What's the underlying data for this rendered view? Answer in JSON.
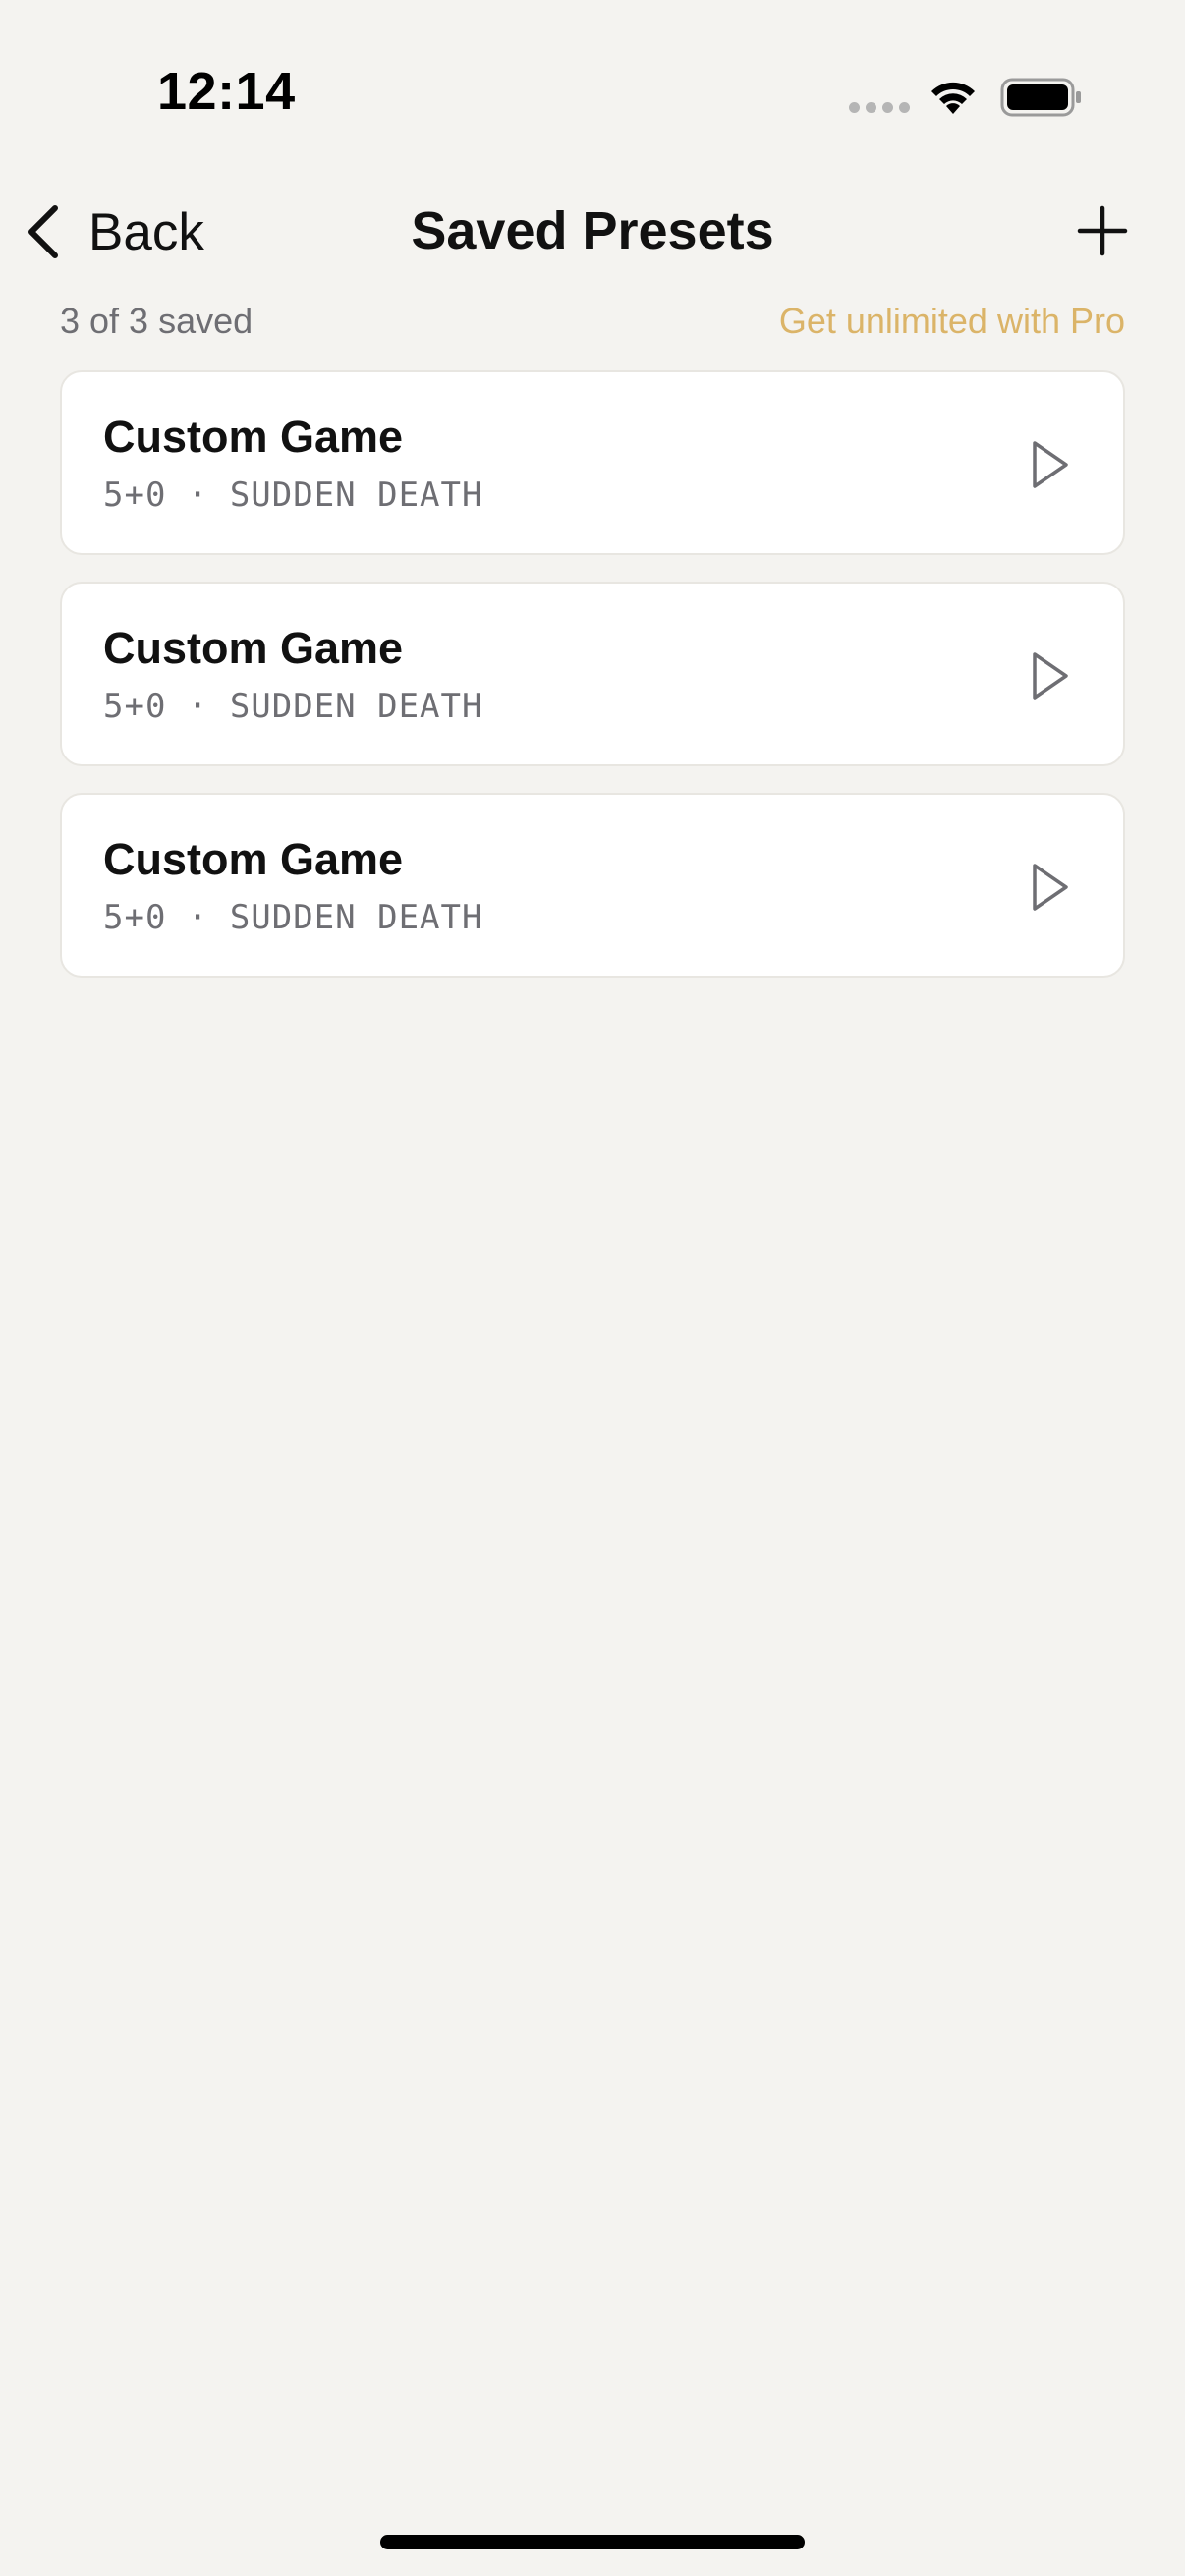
{
  "status_bar": {
    "time": "12:14",
    "icons": [
      "cellular-signal-icon",
      "wifi-icon",
      "battery-icon"
    ]
  },
  "nav": {
    "back_label": "Back",
    "title": "Saved Presets",
    "add_icon": "plus-icon"
  },
  "subheader": {
    "count_text": "3 of 3 saved",
    "pro_link": "Get unlimited with Pro"
  },
  "presets": [
    {
      "name": "Custom Game",
      "detail": "5+0 · SUDDEN DEATH",
      "action_icon": "play-icon"
    },
    {
      "name": "Custom Game",
      "detail": "5+0 · SUDDEN DEATH",
      "action_icon": "play-icon"
    },
    {
      "name": "Custom Game",
      "detail": "5+0 · SUDDEN DEATH",
      "action_icon": "play-icon"
    }
  ],
  "colors": {
    "background": "#f4f3f0",
    "card": "#ffffff",
    "accent_pro": "#dbb468",
    "secondary_text": "#6e6e73"
  }
}
